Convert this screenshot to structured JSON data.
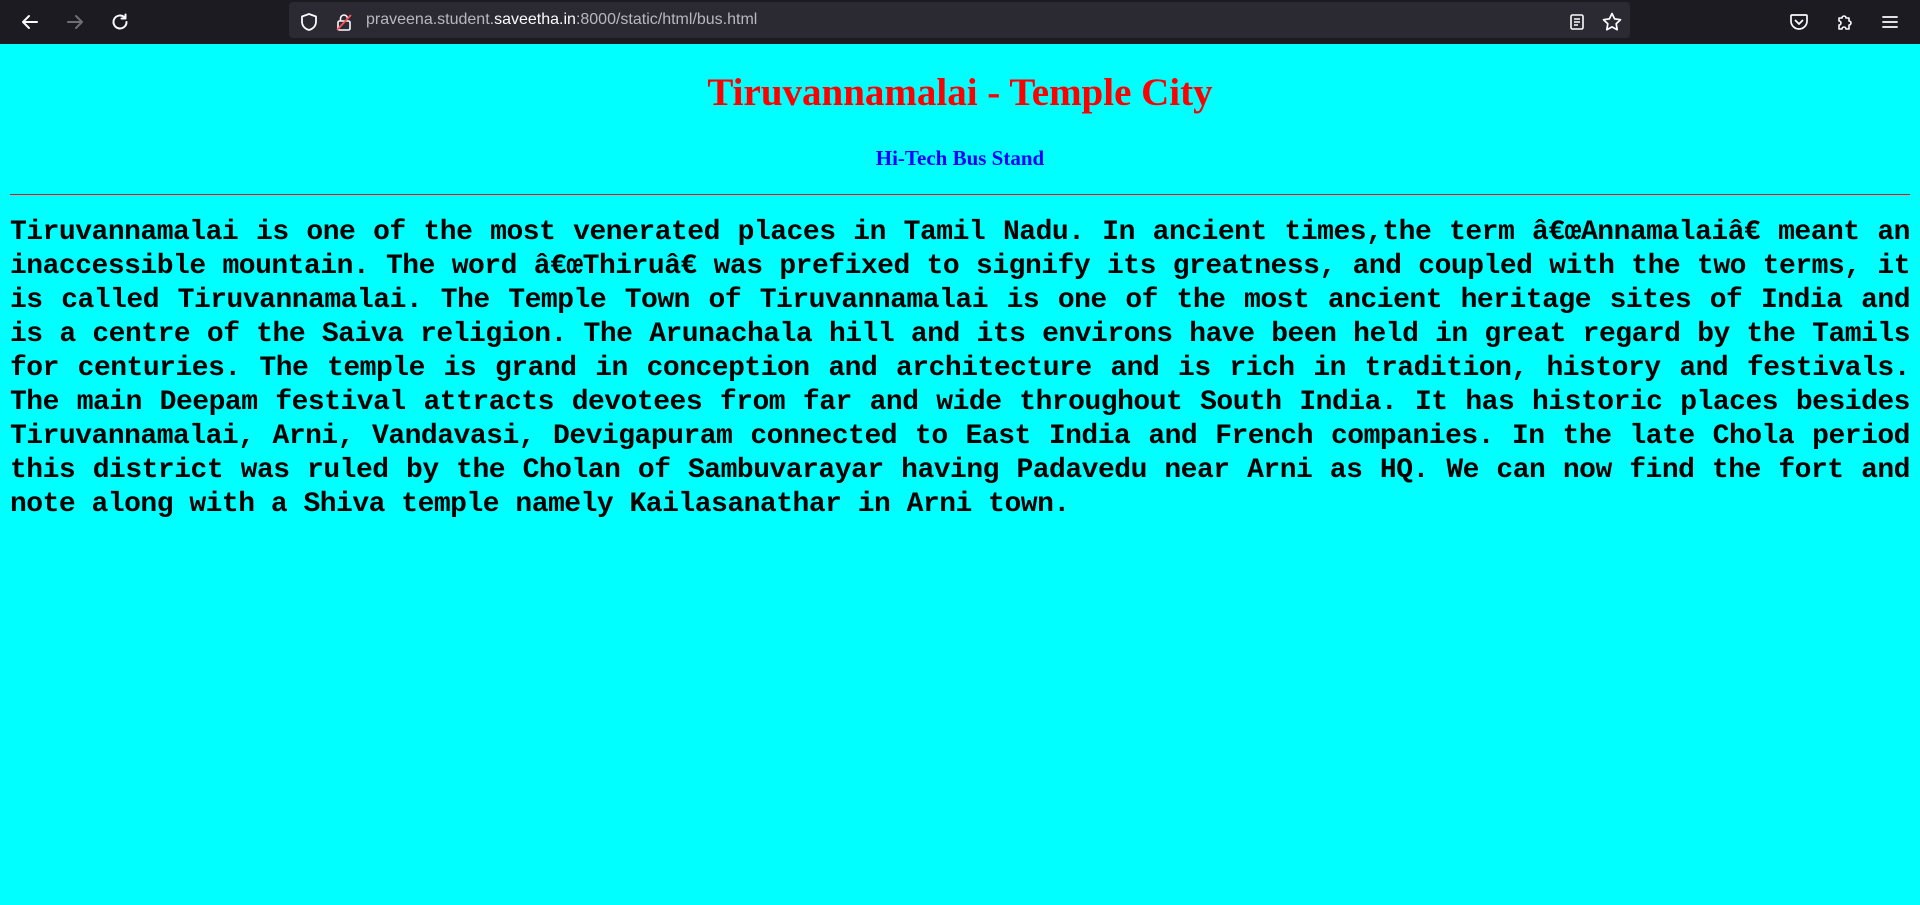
{
  "browser": {
    "url_prefix": "praveena.student.",
    "url_host": "saveetha.in",
    "url_suffix": ":8000/static/html/bus.html",
    "icons": {
      "back": "back-arrow-icon",
      "forward": "forward-arrow-icon",
      "reload": "reload-icon",
      "shield": "shield-icon",
      "insecure_lock": "insecure-lock-icon",
      "reader": "reader-view-icon",
      "bookmark": "star-icon",
      "pocket": "pocket-icon",
      "extensions": "puzzle-icon",
      "menu": "hamburger-menu-icon"
    }
  },
  "page": {
    "title": "Tiruvannamalai - Temple City",
    "subtitle": "Hi-Tech Bus Stand",
    "paragraph": "Tiruvannamalai is one of the most venerated places in Tamil Nadu. In ancient times,the term â€œAnnamalaiâ€ meant an inaccessible mountain. The word â€œThiruâ€ was prefixed to signify its greatness, and coupled with the two terms, it is called Tiruvannamalai. The Temple Town of Tiruvannamalai is one of the most ancient heritage sites of India and is a centre of the Saiva religion. The Arunachala hill and its environs have been held in great regard by the Tamils for centuries. The temple is grand in conception and architecture and is rich in tradition, history and festivals. The main Deepam festival attracts devotees from far and wide throughout South India. It has historic places besides Tiruvannamalai, Arni, Vandavasi, Devigapuram connected to East India and French companies. In the late Chola period this district was ruled by the Cholan of Sambuvarayar having Padavedu near Arni as HQ. We can now find the fort and note along with a Shiva temple namely Kailasanathar in Arni town."
  },
  "colors": {
    "background": "#00ffff",
    "title": "#ff0000",
    "subtitle": "#0000ff",
    "rule": "#e8101a",
    "toolbar": "#1c1b22"
  }
}
